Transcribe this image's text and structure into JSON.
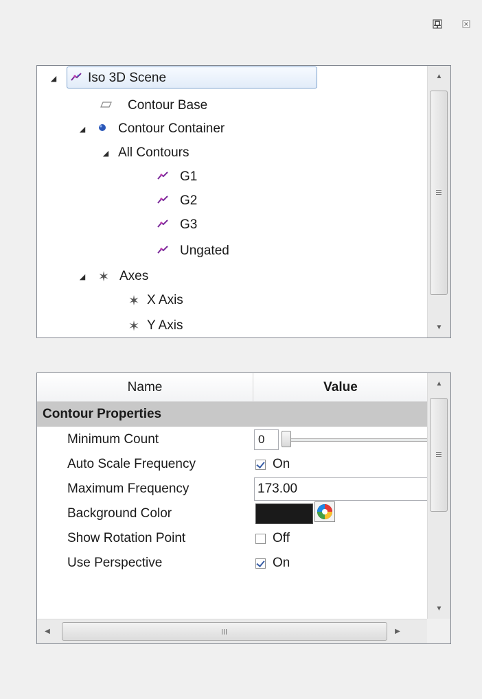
{
  "pane": {
    "pin_icon": "pin-icon",
    "close_icon": "close-icon"
  },
  "tree": {
    "items": [
      {
        "label": "Iso 3D Scene",
        "icon": "scene-icon",
        "expanded": true,
        "selected": true
      },
      {
        "label": "Contour Base",
        "icon": "plane-icon"
      },
      {
        "label": "Contour Container",
        "icon": "sphere-icon",
        "expanded": true
      },
      {
        "label": "All Contours",
        "expanded": true
      },
      {
        "label": "G1",
        "icon": "gate-icon"
      },
      {
        "label": "G2",
        "icon": "gate-icon"
      },
      {
        "label": "G3",
        "icon": "gate-icon"
      },
      {
        "label": "Ungated",
        "icon": "gate-icon"
      },
      {
        "label": "Axes",
        "icon": "axes-icon",
        "expanded": true
      },
      {
        "label": "X Axis",
        "icon": "axis-icon"
      },
      {
        "label": "Y Axis",
        "icon": "axis-icon"
      }
    ]
  },
  "grid": {
    "header_name": "Name",
    "header_value": "Value",
    "category": "Contour Properties",
    "rows": [
      {
        "label": "Minimum Count",
        "value": "0",
        "type": "slider",
        "slider_fraction": 0.0
      },
      {
        "label": "Auto Scale Frequency",
        "value": "On",
        "type": "checkbox",
        "checked": true
      },
      {
        "label": "Maximum Frequency",
        "value": "173.00",
        "type": "text"
      },
      {
        "label": "Background Color",
        "value": "#1a1a1a",
        "type": "color"
      },
      {
        "label": "Show Rotation Point",
        "value": "Off",
        "type": "checkbox",
        "checked": false
      },
      {
        "label": "Use Perspective",
        "value": "On",
        "type": "checkbox",
        "checked": true
      }
    ]
  },
  "colors": {
    "selection_border": "#7da2ce",
    "category_bg": "#c8c8c8",
    "check_mark": "#3a5fa6"
  }
}
